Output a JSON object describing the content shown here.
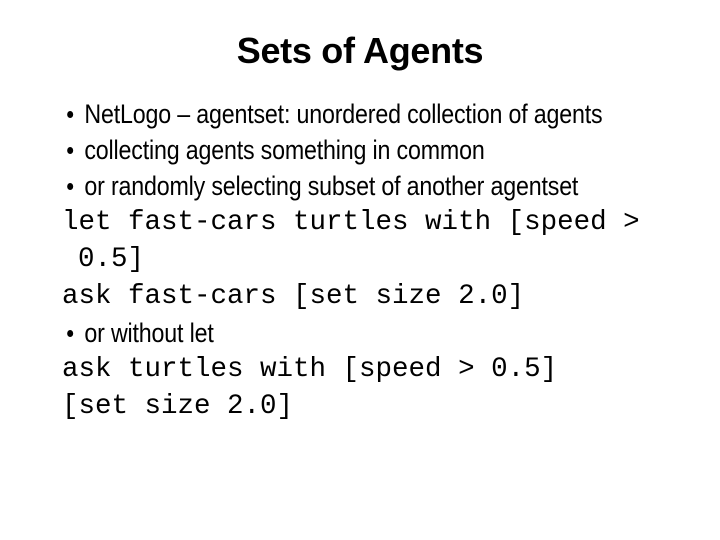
{
  "slide": {
    "title": "Sets of Agents",
    "background_color": "#ffffff",
    "text_color": "#000000",
    "bullet_glyph": "•",
    "body": [
      {
        "kind": "bullet",
        "text": "NetLogo – agentset: unordered collection of agents"
      },
      {
        "kind": "bullet",
        "text": "collecting agents something in common"
      },
      {
        "kind": "bullet",
        "text": "or randomly selecting subset of another agentset"
      },
      {
        "kind": "code",
        "text": "let fast-cars turtles with [speed > 0.5]"
      },
      {
        "kind": "code",
        "text": "ask fast-cars [set size 2.0]"
      },
      {
        "kind": "bullet",
        "text": "or without let"
      },
      {
        "kind": "code",
        "text": "ask turtles with [speed > 0.5]"
      },
      {
        "kind": "code",
        "text": "[set size 2.0]"
      }
    ]
  }
}
